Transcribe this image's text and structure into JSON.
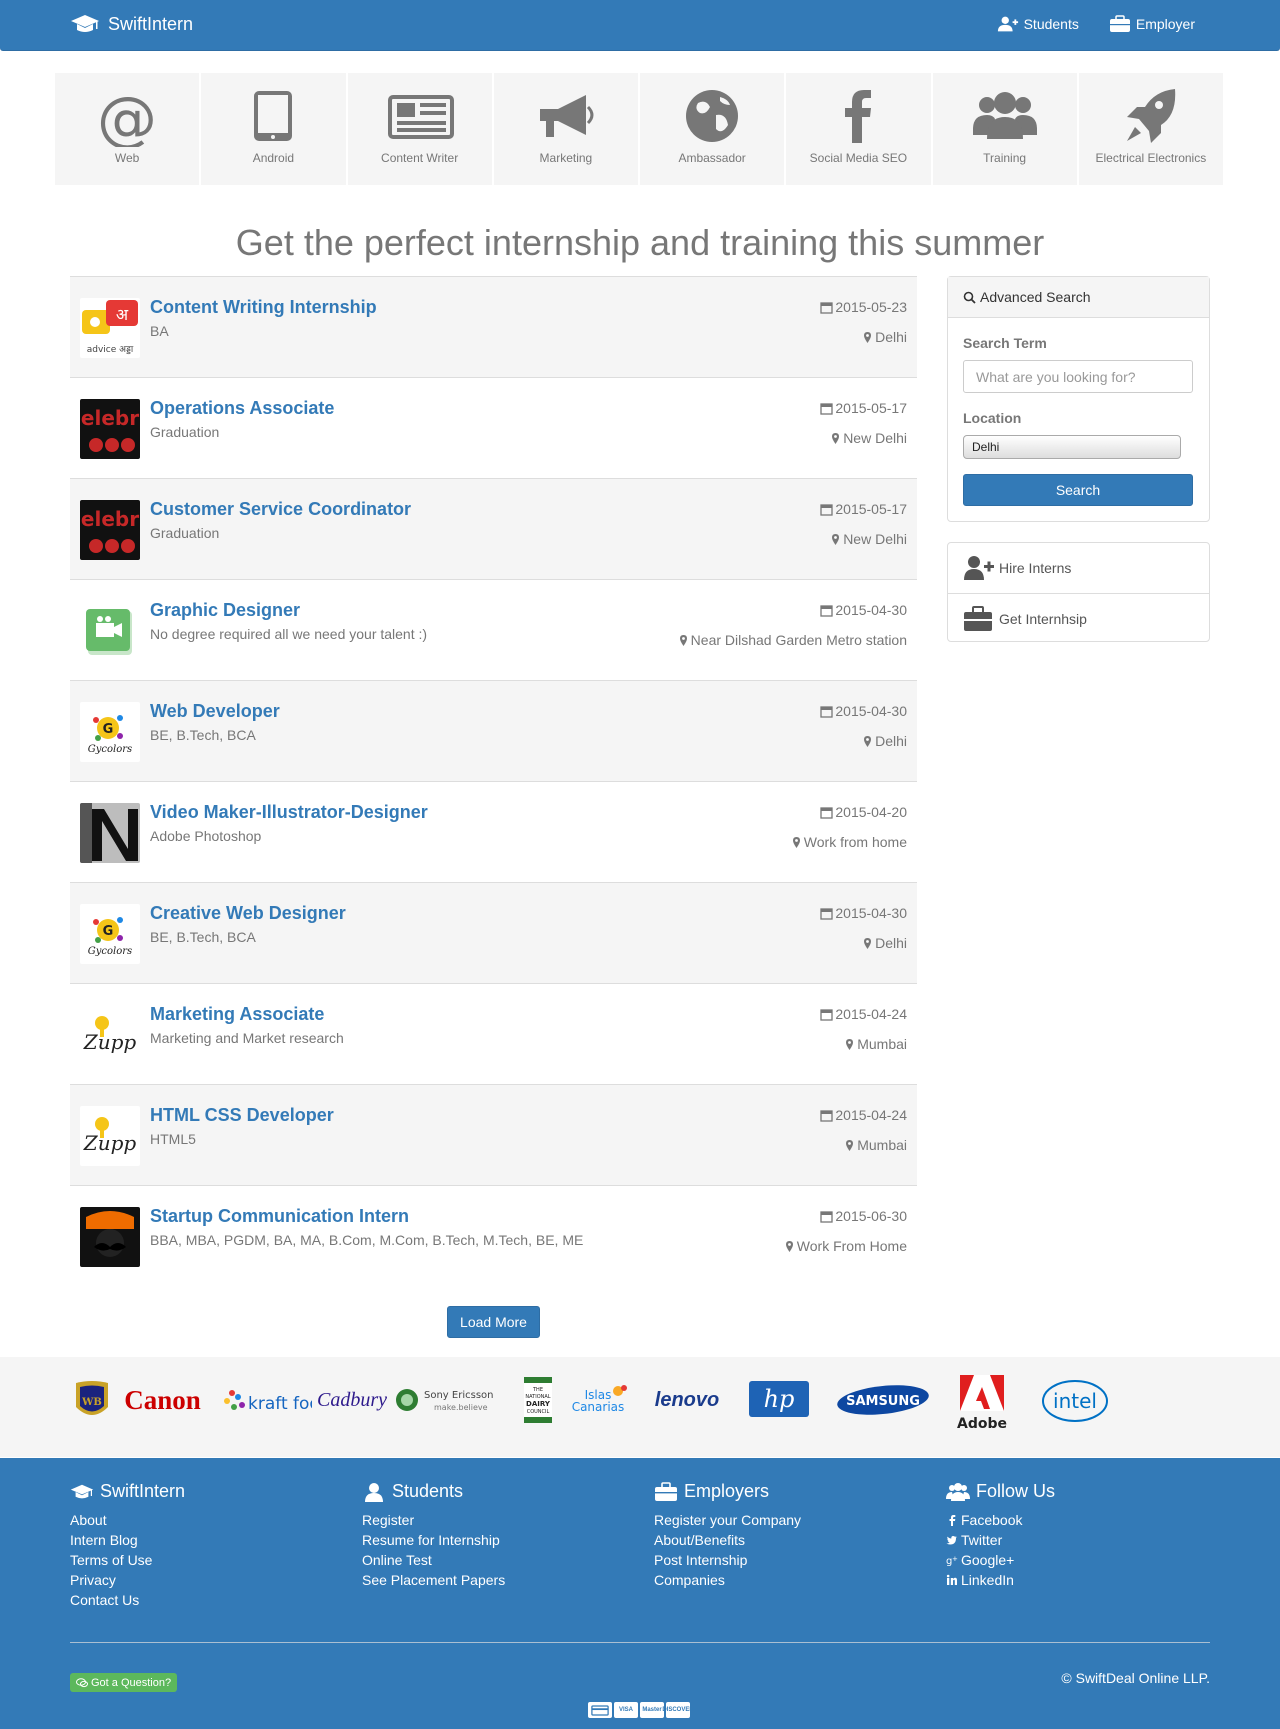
{
  "navbar": {
    "brand": "SwiftIntern",
    "links": [
      {
        "label": "Students",
        "icon": "user-plus-icon"
      },
      {
        "label": "Employer",
        "icon": "briefcase-icon"
      }
    ]
  },
  "categories": [
    {
      "label": "Web",
      "icon": "at-icon"
    },
    {
      "label": "Android",
      "icon": "tablet-icon"
    },
    {
      "label": "Content Writer",
      "icon": "newspaper-icon"
    },
    {
      "label": "Marketing",
      "icon": "megaphone-icon"
    },
    {
      "label": "Ambassador",
      "icon": "globe-icon"
    },
    {
      "label": "Social Media SEO",
      "icon": "facebook-icon"
    },
    {
      "label": "Training",
      "icon": "users-icon"
    },
    {
      "label": "Electrical Electronics",
      "icon": "rocket-icon"
    }
  ],
  "hero": {
    "heading": "Get the perfect internship and training this summer"
  },
  "jobs": [
    {
      "title": "Content Writing Internship",
      "subtitle": "BA",
      "date": "2015-05-23",
      "location": "Delhi",
      "logo": "advice-adda-logo"
    },
    {
      "title": "Operations Associate",
      "subtitle": "Graduation",
      "date": "2015-05-17",
      "location": "New Delhi",
      "logo": "celebritor-logo"
    },
    {
      "title": "Customer Service Coordinator",
      "subtitle": "Graduation",
      "date": "2015-05-17",
      "location": "New Delhi",
      "logo": "celebritor-logo"
    },
    {
      "title": "Graphic Designer",
      "subtitle": "No degree required all we need your talent :)",
      "date": "2015-04-30",
      "location": "Near Dilshad Garden Metro station",
      "logo": "video-camera-logo"
    },
    {
      "title": "Web Developer",
      "subtitle": "BE, B.Tech, BCA",
      "date": "2015-04-30",
      "location": "Delhi",
      "logo": "gycolors-logo"
    },
    {
      "title": "Video Maker-Illustrator-Designer",
      "subtitle": "Adobe Photoshop",
      "date": "2015-04-20",
      "location": "Work from home",
      "logo": "n-letter-logo"
    },
    {
      "title": "Creative Web Designer",
      "subtitle": "BE, B.Tech, BCA",
      "date": "2015-04-30",
      "location": "Delhi",
      "logo": "gycolors-logo"
    },
    {
      "title": "Marketing Associate",
      "subtitle": "Marketing and Market research",
      "date": "2015-04-24",
      "location": "Mumbai",
      "logo": "zupp-logo"
    },
    {
      "title": "HTML CSS Developer",
      "subtitle": "HTML5",
      "date": "2015-04-24",
      "location": "Mumbai",
      "logo": "zupp-logo"
    },
    {
      "title": "Startup Communication Intern",
      "subtitle": "BBA, MBA, PGDM, BA, MA, B.Com, M.Com, B.Tech, M.Tech, BE, ME",
      "date": "2015-06-30",
      "location": "Work From Home",
      "logo": "mustache-logo"
    }
  ],
  "load_more": "Load More",
  "advanced_search": {
    "heading": "Advanced Search",
    "term_label": "Search Term",
    "term_placeholder": "What are you looking for?",
    "term_value": "",
    "location_label": "Location",
    "location_value": "Delhi",
    "button": "Search"
  },
  "side_links": [
    {
      "label": "Hire Interns",
      "icon": "user-plus-icon"
    },
    {
      "label": "Get Internhsip",
      "icon": "briefcase-icon"
    }
  ],
  "brands": {
    "canon": "Canon",
    "kraft": "kraft foods",
    "cadbury": "Cadbury",
    "sony1": "Sony Ericsson",
    "sony2": "make.believe",
    "dairy1": "THE",
    "dairy2": "NATIONAL",
    "dairy3": "DAIRY",
    "dairy4": "COUNCIL",
    "islas1": "Islas",
    "islas2": "Canarias",
    "lenovo": "lenovo",
    "hp": "hp",
    "samsung": "SAMSUNG",
    "adobe": "Adobe",
    "intel": "intel"
  },
  "footer": {
    "columns": [
      {
        "heading": "SwiftIntern",
        "icon": "graduation-cap-icon",
        "links": [
          "About",
          "Intern Blog",
          "Terms of Use",
          "Privacy",
          "Contact Us"
        ]
      },
      {
        "heading": "Students",
        "icon": "user-icon",
        "links": [
          "Register",
          "Resume for Internship",
          "Online Test",
          "See Placement Papers"
        ]
      },
      {
        "heading": "Employers",
        "icon": "briefcase-icon",
        "links": [
          "Register your Company",
          "About/Benefits",
          "Post Internship",
          "Companies"
        ]
      },
      {
        "heading": "Follow Us",
        "icon": "users-icon",
        "links": [
          "Facebook",
          "Twitter",
          "Google+",
          "LinkedIn"
        ]
      }
    ],
    "question": "Got a Question?",
    "copyright": "©  SwiftDeal Online LLP.",
    "payments": [
      "VISA",
      "Master",
      "DISCOVER"
    ]
  },
  "colors": {
    "primary": "#337ab7",
    "success": "#5cb85c",
    "muted": "#777777",
    "panel": "#f5f5f5"
  }
}
